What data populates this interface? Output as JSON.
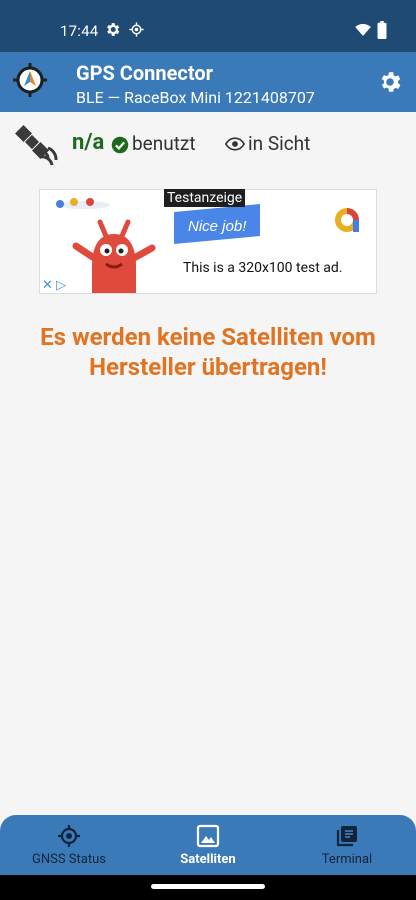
{
  "status_bar": {
    "time": "17:44",
    "icons": [
      "gear-icon",
      "gps-fix-icon",
      "wifi-icon",
      "battery-icon"
    ]
  },
  "app_bar": {
    "title": "GPS Connector",
    "subtitle": "BLE — RaceBox Mini 1221408707",
    "icons": [
      "app-logo",
      "settings-gear-icon"
    ]
  },
  "satellite_status": {
    "used_count": "n/a",
    "used_label": "benutzt",
    "visible_label": "in Sicht"
  },
  "ad": {
    "tag": "Testanzeige",
    "headline": "Nice job!",
    "text": "This is a 320x100 test ad."
  },
  "message": "Es werden keine Satelliten vom Hersteller übertragen!",
  "bottom_nav": {
    "items": [
      {
        "label": "GNSS Status",
        "icon": "gnss-status-icon"
      },
      {
        "label": "Satelliten",
        "icon": "satellite-image-icon",
        "active": true
      },
      {
        "label": "Terminal",
        "icon": "terminal-library-icon"
      }
    ]
  },
  "colors": {
    "status_bar": "#1e4a73",
    "app_bar": "#3b7ab8",
    "message": "#e07422",
    "used_count": "#1c6b1c",
    "background": "#f5f5f5"
  }
}
